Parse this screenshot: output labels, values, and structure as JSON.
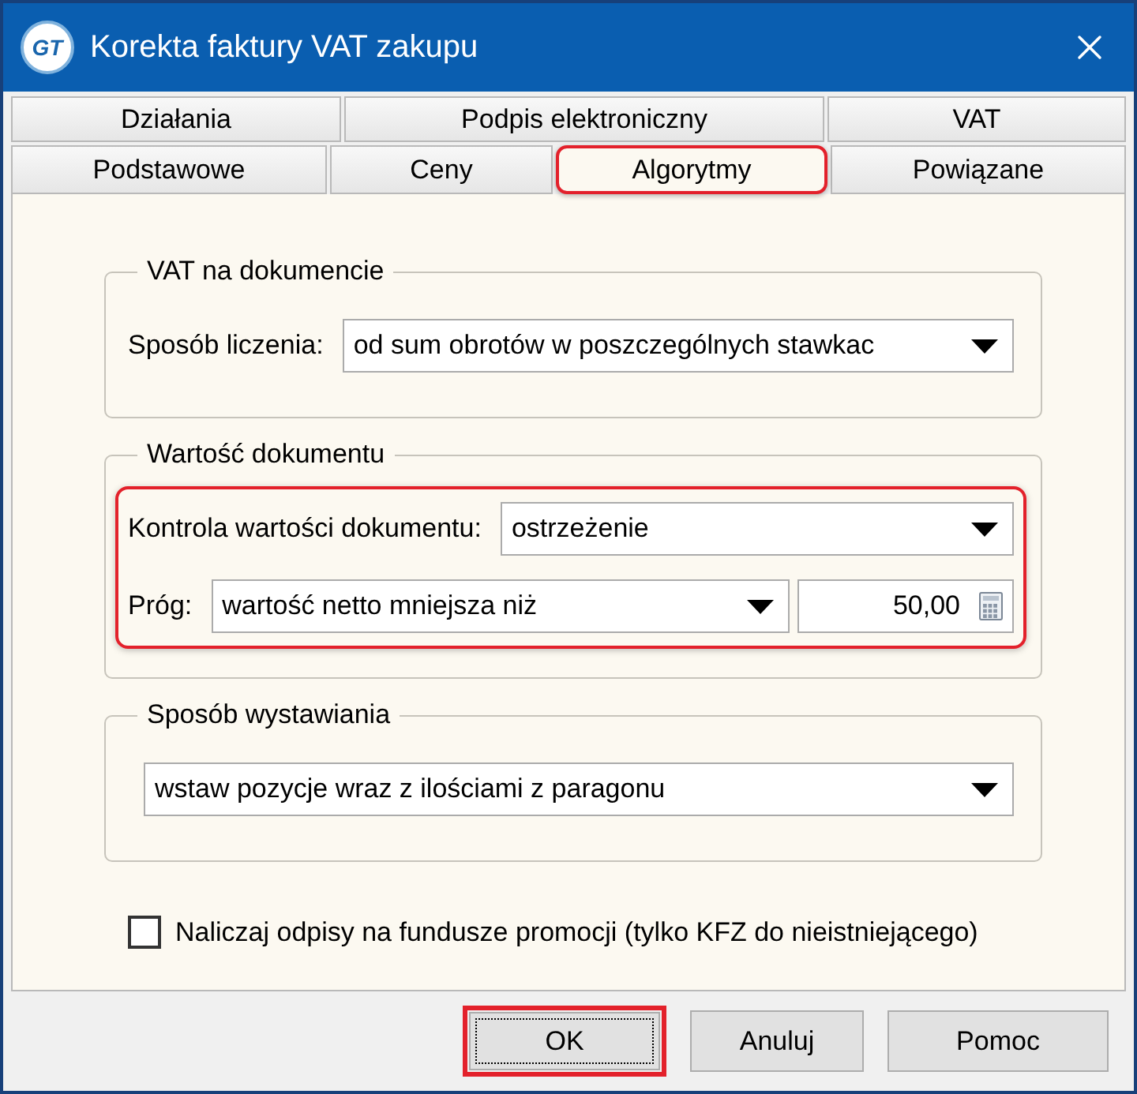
{
  "window": {
    "title": "Korekta faktury VAT zakupu",
    "logo_text": "GT"
  },
  "tab_rows": [
    {
      "tabs": [
        {
          "label": "Działania",
          "selected": false,
          "highlighted": false
        },
        {
          "label": "Podpis elektroniczny",
          "selected": false,
          "highlighted": false
        },
        {
          "label": "VAT",
          "selected": false,
          "highlighted": false
        }
      ]
    },
    {
      "tabs": [
        {
          "label": "Podstawowe",
          "selected": false,
          "highlighted": false
        },
        {
          "label": "Ceny",
          "selected": false,
          "highlighted": false
        },
        {
          "label": "Algorytmy",
          "selected": true,
          "highlighted": true
        },
        {
          "label": "Powiązane",
          "selected": false,
          "highlighted": false
        }
      ]
    }
  ],
  "groups": [
    {
      "title": "VAT na dokumencie",
      "highlighted": false,
      "rows": [
        {
          "label": "Sposób liczenia:",
          "fields": [
            {
              "kind": "dropdown",
              "value": "od sum obrotów w poszczególnych stawkac"
            }
          ]
        }
      ]
    },
    {
      "title": "Wartość dokumentu",
      "highlighted": true,
      "rows": [
        {
          "label": "Kontrola wartości dokumentu:",
          "fields": [
            {
              "kind": "dropdown",
              "value": "ostrzeżenie"
            }
          ]
        },
        {
          "label": "Próg:",
          "fields": [
            {
              "kind": "dropdown",
              "value": "wartość netto mniejsza niż"
            },
            {
              "kind": "number",
              "value": "50,00"
            }
          ]
        }
      ]
    },
    {
      "title": "Sposób wystawiania",
      "highlighted": false,
      "rows": [
        {
          "fields": [
            {
              "kind": "dropdown",
              "value": "wstaw pozycje wraz z ilościami z paragonu"
            }
          ]
        }
      ]
    }
  ],
  "checkbox": {
    "label": "Naliczaj odpisy na fundusze promocji (tylko KFZ do nieistniejącego)",
    "checked": false
  },
  "buttons": [
    {
      "label": "OK",
      "focused": true,
      "highlighted": true
    },
    {
      "label": "Anuluj",
      "focused": false,
      "highlighted": false
    },
    {
      "label": "Pomoc",
      "focused": false,
      "highlighted": false
    }
  ]
}
